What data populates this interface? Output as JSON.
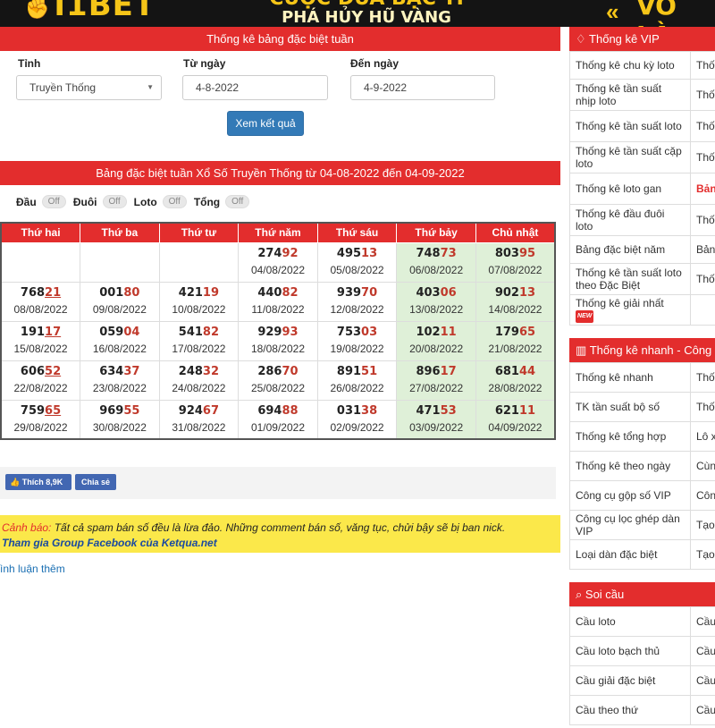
{
  "banner": {
    "logo": "I1BET",
    "slogan_line1": "CUỘC ĐUA BẠC TỈ",
    "slogan_line2": "PHÁ HỦY HŨ VÀNG",
    "cta": "VÔ LÀ"
  },
  "filter": {
    "header": "Thống kê bảng đặc biệt tuần",
    "province_label": "Tỉnh",
    "from_label": "Từ ngày",
    "to_label": "Đến ngày",
    "province_value": "Truyền Thống",
    "from_value": "4-8-2022",
    "to_value": "4-9-2022",
    "submit": "Xem kết quả"
  },
  "result": {
    "header": "Bảng đặc biệt tuần Xổ Số Truyền Thống từ 04-08-2022 đến 04-09-2022",
    "toggles": [
      {
        "label": "Đầu",
        "state": "Off"
      },
      {
        "label": "Đuôi",
        "state": "Off"
      },
      {
        "label": "Loto",
        "state": "Off"
      },
      {
        "label": "Tổng",
        "state": "Off"
      }
    ],
    "days": [
      "Thứ hai",
      "Thứ ba",
      "Thứ tư",
      "Thứ năm",
      "Thứ sáu",
      "Thứ bảy",
      "Chủ nhật"
    ],
    "rows": [
      [
        null,
        null,
        null,
        {
          "head": "274",
          "tail": "92",
          "date": "04/08/2022"
        },
        {
          "head": "495",
          "tail": "13",
          "date": "05/08/2022"
        },
        {
          "head": "748",
          "tail": "73",
          "date": "06/08/2022"
        },
        {
          "head": "803",
          "tail": "95",
          "date": "07/08/2022"
        }
      ],
      [
        {
          "head": "768",
          "tail": "21",
          "date": "08/08/2022",
          "mark": true
        },
        {
          "head": "001",
          "tail": "80",
          "date": "09/08/2022"
        },
        {
          "head": "421",
          "tail": "19",
          "date": "10/08/2022"
        },
        {
          "head": "440",
          "tail": "82",
          "date": "11/08/2022"
        },
        {
          "head": "939",
          "tail": "70",
          "date": "12/08/2022"
        },
        {
          "head": "403",
          "tail": "06",
          "date": "13/08/2022"
        },
        {
          "head": "902",
          "tail": "13",
          "date": "14/08/2022"
        }
      ],
      [
        {
          "head": "191",
          "tail": "17",
          "date": "15/08/2022",
          "mark": true
        },
        {
          "head": "059",
          "tail": "04",
          "date": "16/08/2022"
        },
        {
          "head": "541",
          "tail": "82",
          "date": "17/08/2022"
        },
        {
          "head": "929",
          "tail": "93",
          "date": "18/08/2022"
        },
        {
          "head": "753",
          "tail": "03",
          "date": "19/08/2022"
        },
        {
          "head": "102",
          "tail": "11",
          "date": "20/08/2022"
        },
        {
          "head": "179",
          "tail": "65",
          "date": "21/08/2022"
        }
      ],
      [
        {
          "head": "606",
          "tail": "52",
          "date": "22/08/2022",
          "mark": true
        },
        {
          "head": "634",
          "tail": "37",
          "date": "23/08/2022"
        },
        {
          "head": "248",
          "tail": "32",
          "date": "24/08/2022"
        },
        {
          "head": "286",
          "tail": "70",
          "date": "25/08/2022"
        },
        {
          "head": "891",
          "tail": "51",
          "date": "26/08/2022"
        },
        {
          "head": "896",
          "tail": "17",
          "date": "27/08/2022"
        },
        {
          "head": "681",
          "tail": "44",
          "date": "28/08/2022"
        }
      ],
      [
        {
          "head": "759",
          "tail": "65",
          "date": "29/08/2022",
          "mark": true
        },
        {
          "head": "969",
          "tail": "55",
          "date": "30/08/2022"
        },
        {
          "head": "924",
          "tail": "67",
          "date": "31/08/2022"
        },
        {
          "head": "694",
          "tail": "88",
          "date": "01/09/2022"
        },
        {
          "head": "031",
          "tail": "38",
          "date": "02/09/2022"
        },
        {
          "head": "471",
          "tail": "53",
          "date": "03/09/2022"
        },
        {
          "head": "621",
          "tail": "11",
          "date": "04/09/2022"
        }
      ]
    ]
  },
  "social": {
    "like_label": "Thích 8,9K",
    "share_label": "Chia sẻ"
  },
  "warning": {
    "lead": "Cảnh báo:",
    "text": " Tất cả spam bán số đều là lừa đảo. Những comment bán số, văng tục, chửi bậy sẽ bị ban nick.",
    "join": "Tham gia Group Facebook của Ketqua.net"
  },
  "more_link": "ình luận thêm",
  "sidebar": {
    "vip": {
      "title": "Thống kê VIP",
      "rows": [
        {
          "name": "Thống kê chu kỳ loto",
          "desc": "Thốn"
        },
        {
          "name": "Thống kê tần suất nhịp loto",
          "desc": "Thốn đặc b"
        },
        {
          "name": "Thống kê tần suất loto",
          "desc": "Thốn loto"
        },
        {
          "name": "Thống kê tần suất cặp loto",
          "desc": "Thốn dàn c"
        },
        {
          "name": "Thống kê loto gan",
          "desc": "Bảng",
          "red": true
        },
        {
          "name": "Thống kê đầu đuôi loto",
          "desc": "Thốn"
        },
        {
          "name": "Bảng đặc biệt năm",
          "desc": "Bảng"
        },
        {
          "name": "Thống kê tần suất loto theo Đặc Biệt",
          "desc": "Thốn theo"
        },
        {
          "name": "Thống kê giải nhất",
          "desc": "",
          "badge": "NEW"
        }
      ]
    },
    "quick": {
      "title": "Thống kê nhanh - Công",
      "rows": [
        {
          "name": "Thống kê nhanh",
          "desc": "Thốn"
        },
        {
          "name": "TK tần suất bộ số",
          "desc": "Thốn"
        },
        {
          "name": "Thống kê tổng hợp",
          "desc": "Lô xi"
        },
        {
          "name": "Thống kê theo ngày",
          "desc": "Cùng"
        },
        {
          "name": "Công cụ gộp số VIP",
          "desc": "Công"
        },
        {
          "name": "Công cụ lọc ghép dàn VIP",
          "desc": "Tạo r"
        },
        {
          "name": "Loại dàn đặc biệt",
          "desc": "Tạo c"
        }
      ]
    },
    "soicau": {
      "title": "Soi cầu",
      "rows": [
        {
          "name": "Cầu loto",
          "desc": "Cầu l"
        },
        {
          "name": "Cầu loto bạch thủ",
          "desc": "Cầu l"
        },
        {
          "name": "Cầu giải đặc biệt",
          "desc": "Cầu c"
        },
        {
          "name": "Cầu theo thứ",
          "desc": "Cầu t"
        }
      ]
    }
  }
}
